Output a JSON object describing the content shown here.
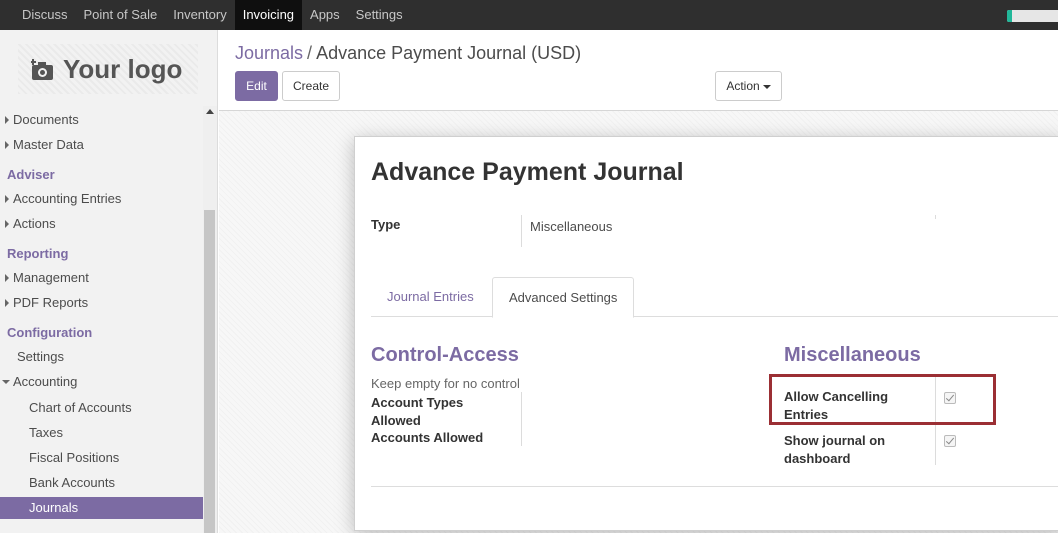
{
  "topnav": {
    "items": [
      "Discuss",
      "Point of Sale",
      "Inventory",
      "Invoicing",
      "Apps",
      "Settings"
    ],
    "active_index": 3,
    "progress_fraction": 0.1
  },
  "sidebar": {
    "logo": {
      "icon": "camera-plus-icon",
      "text": "Your logo"
    },
    "items": [
      {
        "label": "Documents",
        "kind": "group"
      },
      {
        "label": "Master Data",
        "kind": "group"
      },
      {
        "label": "Adviser",
        "kind": "header"
      },
      {
        "label": "Accounting Entries",
        "kind": "group"
      },
      {
        "label": "Actions",
        "kind": "group"
      },
      {
        "label": "Reporting",
        "kind": "header"
      },
      {
        "label": "Management",
        "kind": "group"
      },
      {
        "label": "PDF Reports",
        "kind": "group"
      },
      {
        "label": "Configuration",
        "kind": "header"
      },
      {
        "label": "Settings",
        "kind": "item"
      },
      {
        "label": "Accounting",
        "kind": "group-open"
      },
      {
        "label": "Chart of Accounts",
        "kind": "subitem"
      },
      {
        "label": "Taxes",
        "kind": "subitem"
      },
      {
        "label": "Fiscal Positions",
        "kind": "subitem"
      },
      {
        "label": "Bank Accounts",
        "kind": "subitem"
      },
      {
        "label": "Journals",
        "kind": "subitem",
        "selected": true
      }
    ]
  },
  "breadcrumb": {
    "parent": "Journals",
    "separator": "/",
    "current": "Advance Payment Journal (USD)"
  },
  "toolbar": {
    "edit_label": "Edit",
    "create_label": "Create",
    "action_label": "Action"
  },
  "form": {
    "title": "Advance Payment Journal",
    "type_label": "Type",
    "type_value": "Miscellaneous",
    "tabs": [
      "Journal Entries",
      "Advanced Settings"
    ],
    "active_tab_index": 1,
    "control_access": {
      "title": "Control-Access",
      "help": "Keep empty for no control",
      "account_types_label": "Account Types Allowed",
      "accounts_allowed_label": "Accounts Allowed"
    },
    "miscellaneous": {
      "title": "Miscellaneous",
      "allow_cancel_label": "Allow Cancelling Entries",
      "allow_cancel_checked": true,
      "show_dashboard_label": "Show journal on dashboard",
      "show_dashboard_checked": true
    }
  },
  "colors": {
    "brand": "#7c6ba3",
    "topbar": "#2f2f2f",
    "highlight": "#9b2f34",
    "progress": "#21b799"
  }
}
